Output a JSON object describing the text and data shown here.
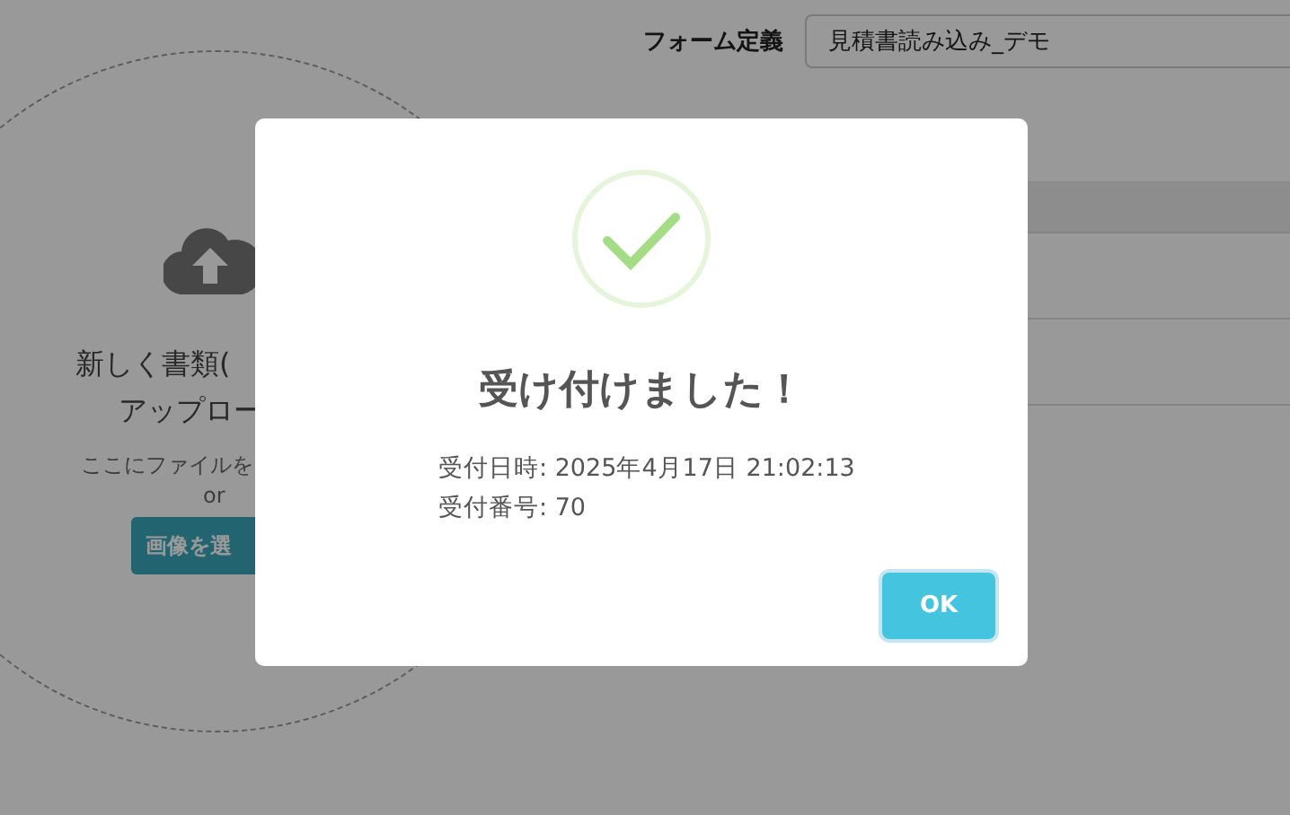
{
  "form_definition": {
    "label": "フォーム定義",
    "value": "見積書読み込み_デモ"
  },
  "upload": {
    "title_lines": [
      "新しく書類(",
      "アップロー"
    ],
    "hint": "ここにファイルを",
    "or": "or",
    "button": "画像を選"
  },
  "dialog": {
    "title": "受け付けました！",
    "details": [
      "受付日時: 2025年4月17日 21:02:13",
      "受付番号: 70"
    ],
    "ok_button": "OK"
  }
}
